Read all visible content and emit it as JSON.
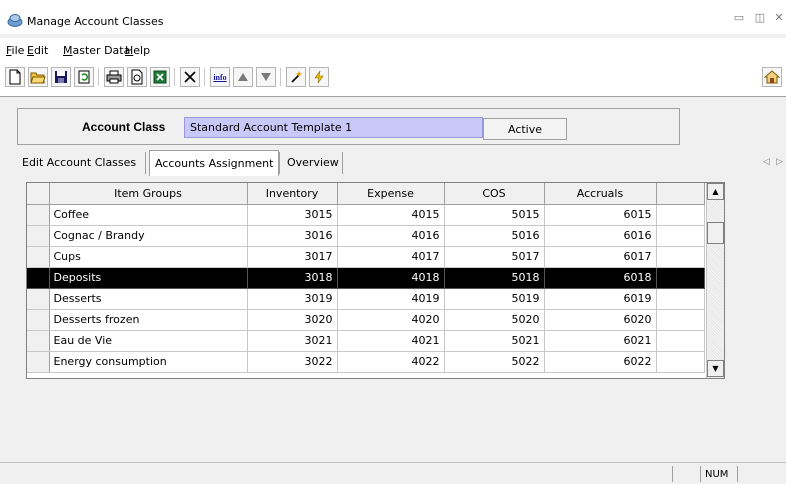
{
  "window": {
    "title": "Manage Account Classes",
    "controls": [
      "minimize",
      "restore",
      "close"
    ]
  },
  "menu": {
    "items": [
      {
        "label": "File",
        "mnemonic": "F",
        "rest": "ile"
      },
      {
        "label": "Edit",
        "mnemonic": "E",
        "rest": "dit"
      },
      {
        "label": "Master Data",
        "mnemonic": "M",
        "rest": "aster Data"
      },
      {
        "label": "Help",
        "mnemonic": "H",
        "rest": "elp"
      }
    ]
  },
  "toolbar": {
    "icons": [
      "new-document-icon",
      "open-folder-icon",
      "save-icon",
      "refresh-icon",
      "print-icon",
      "print-preview-icon",
      "excel-export-icon",
      "delete-icon",
      "info-icon",
      "move-up-icon",
      "move-down-icon",
      "wizard-icon",
      "lightning-icon",
      "home-icon"
    ],
    "info_label": "info"
  },
  "account_class": {
    "label": "Account Class",
    "value": "Standard Account Template 1",
    "status_button": "Active"
  },
  "tabs": [
    {
      "label": "Edit Account Classes",
      "selected": false
    },
    {
      "label": "Accounts Assignment",
      "selected": true
    },
    {
      "label": "Overview",
      "selected": false
    }
  ],
  "tab_nav": {
    "prev": "◁",
    "next": "▷"
  },
  "grid": {
    "columns": [
      "Item Groups",
      "Inventory",
      "Expense",
      "COS",
      "Accruals"
    ],
    "rows": [
      {
        "name": "Coffee",
        "values": [
          "3015",
          "4015",
          "5015",
          "6015"
        ],
        "selected": false
      },
      {
        "name": "Cognac / Brandy",
        "values": [
          "3016",
          "4016",
          "5016",
          "6016"
        ],
        "selected": false
      },
      {
        "name": "Cups",
        "values": [
          "3017",
          "4017",
          "5017",
          "6017"
        ],
        "selected": false
      },
      {
        "name": "Deposits",
        "values": [
          "3018",
          "4018",
          "5018",
          "6018"
        ],
        "selected": true
      },
      {
        "name": "Desserts",
        "values": [
          "3019",
          "4019",
          "5019",
          "6019"
        ],
        "selected": false
      },
      {
        "name": "Desserts frozen",
        "values": [
          "3020",
          "4020",
          "5020",
          "6020"
        ],
        "selected": false
      },
      {
        "name": "Eau de Vie",
        "values": [
          "3021",
          "4021",
          "5021",
          "6021"
        ],
        "selected": false
      },
      {
        "name": "Energy consumption",
        "values": [
          "3022",
          "4022",
          "5022",
          "6022"
        ],
        "selected": false
      }
    ]
  },
  "status": {
    "num": "NUM"
  }
}
